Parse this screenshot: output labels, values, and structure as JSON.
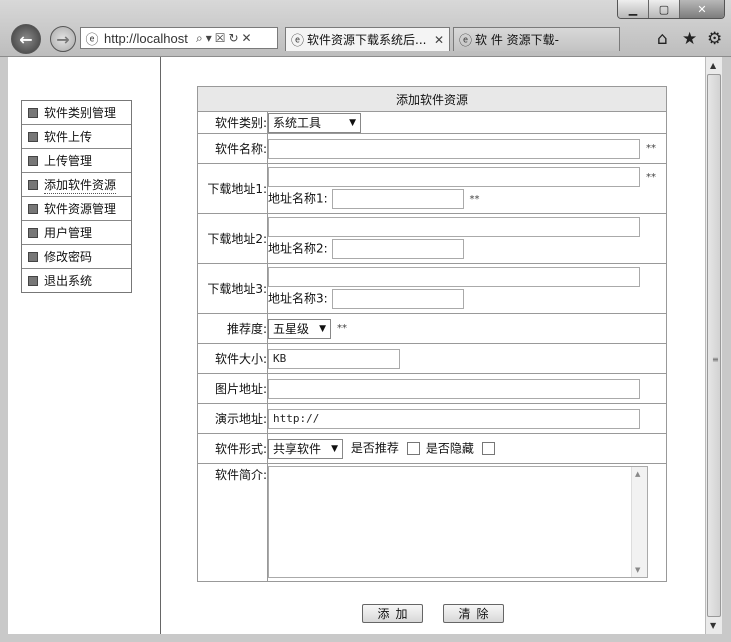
{
  "browser": {
    "address_url": "http://localhost",
    "address_tools": "⌕▾☒↻✕",
    "tabs": [
      {
        "title": "软件资源下载系统后...",
        "close": "✕"
      },
      {
        "title": "软 件 资源下载-"
      }
    ],
    "icons": [
      "back-icon",
      "forward-icon",
      "ie-icon",
      "home-icon",
      "favorites-icon",
      "gear-icon",
      "minimize-icon",
      "maximize-icon",
      "close-icon"
    ]
  },
  "sidebar": {
    "items": [
      {
        "label": "软件类别管理"
      },
      {
        "label": "软件上传"
      },
      {
        "label": "上传管理"
      },
      {
        "label": "添加软件资源"
      },
      {
        "label": "软件资源管理"
      },
      {
        "label": "用户管理"
      },
      {
        "label": "修改密码"
      },
      {
        "label": "退出系统"
      }
    ]
  },
  "form": {
    "title": "添加软件资源",
    "category_label": "软件类别:",
    "category_value": "系统工具",
    "name_label": "软件名称:",
    "required_mark": "**",
    "url1_label": "下载地址1:",
    "url1_name_label": "地址名称1:",
    "url2_label": "下载地址2:",
    "url2_name_label": "地址名称2:",
    "url3_label": "下载地址3:",
    "url3_name_label": "地址名称3:",
    "rating_label": "推荐度:",
    "rating_value": "五星级",
    "size_label": "软件大小:",
    "size_value": "KB",
    "image_label": "图片地址:",
    "demo_label": "演示地址:",
    "demo_value": "http://",
    "type_label": "软件形式:",
    "type_value": "共享软件",
    "recommend_label": "是否推荐",
    "hidden_label": "是否隐藏",
    "intro_label": "软件简介:"
  },
  "buttons": {
    "add": "添加",
    "clear": "清除"
  }
}
